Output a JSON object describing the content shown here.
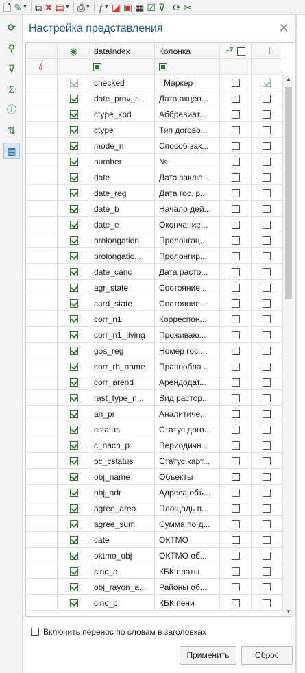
{
  "toolbar": {
    "icons": [
      "new-document-icon",
      "edit-pencil-icon",
      "copy-icon",
      "delete-icon",
      "export-icon",
      "print-icon",
      "formula-icon",
      "flag-icon",
      "report-icon",
      "preview-icon",
      "check-icon",
      "filter-icon",
      "refresh-icon",
      "tools-icon"
    ]
  },
  "sidebar": {
    "icons": [
      "refresh-icon",
      "search-icon",
      "filter-icon",
      "sum-icon",
      "info-icon",
      "sort-icon",
      "view-settings-icon"
    ],
    "glyphs": [
      "⟳",
      "⚲",
      "⊽",
      "Σ",
      "ⓘ",
      "⇅",
      "▦"
    ]
  },
  "panel": {
    "title": "Настройка представления",
    "close_glyph": "✕"
  },
  "grid": {
    "columns": {
      "visible_icon": "◉",
      "dataindex": "dataIndex",
      "kolonka": "Колонка",
      "wrap_icon": "⮐",
      "pin_icon": "⊣"
    },
    "rows": [
      {
        "visible": true,
        "gray": true,
        "dataindex": "checked",
        "kolonka": "=Маркер=",
        "wrap": false,
        "pinned": true
      },
      {
        "visible": true,
        "dataindex": "date_prov_r...",
        "kolonka": "Дата акцеп...",
        "wrap": false,
        "pinned": false
      },
      {
        "visible": true,
        "dataindex": "ctype_kod",
        "kolonka": "Аббревиат...",
        "wrap": false,
        "pinned": false
      },
      {
        "visible": true,
        "dataindex": "ctype",
        "kolonka": "Тип догово...",
        "wrap": false,
        "pinned": false
      },
      {
        "visible": true,
        "dataindex": "mode_n",
        "kolonka": "Способ зак...",
        "wrap": false,
        "pinned": false
      },
      {
        "visible": true,
        "dataindex": "number",
        "kolonka": "№",
        "wrap": false,
        "pinned": false
      },
      {
        "visible": true,
        "dataindex": "date",
        "kolonka": "Дата заклю...",
        "wrap": false,
        "pinned": false
      },
      {
        "visible": true,
        "dataindex": "date_reg",
        "kolonka": "Дата гос. р...",
        "wrap": false,
        "pinned": false
      },
      {
        "visible": true,
        "dataindex": "date_b",
        "kolonka": "Начало дей...",
        "wrap": false,
        "pinned": false
      },
      {
        "visible": true,
        "dataindex": "date_e",
        "kolonka": "Окончание...",
        "wrap": false,
        "pinned": false
      },
      {
        "visible": true,
        "dataindex": "prolongation",
        "kolonka": "Пролонгац...",
        "wrap": false,
        "pinned": false
      },
      {
        "visible": true,
        "dataindex": "prolongatio...",
        "kolonka": "Пролонгир...",
        "wrap": false,
        "pinned": false
      },
      {
        "visible": true,
        "dataindex": "date_canc",
        "kolonka": "Дата расто...",
        "wrap": false,
        "pinned": false
      },
      {
        "visible": true,
        "dataindex": "agr_state",
        "kolonka": "Состояние ...",
        "wrap": false,
        "pinned": false
      },
      {
        "visible": true,
        "dataindex": "card_state",
        "kolonka": "Состояние ...",
        "wrap": false,
        "pinned": false
      },
      {
        "visible": true,
        "dataindex": "corr_n1",
        "kolonka": "Корреспон...",
        "wrap": false,
        "pinned": false
      },
      {
        "visible": true,
        "dataindex": "corr_n1_living",
        "kolonka": "Проживаю...",
        "wrap": false,
        "pinned": false
      },
      {
        "visible": true,
        "dataindex": "gos_reg",
        "kolonka": "Номер гос....",
        "wrap": false,
        "pinned": false
      },
      {
        "visible": true,
        "dataindex": "corr_rh_name",
        "kolonka": "Правообла...",
        "wrap": false,
        "pinned": false
      },
      {
        "visible": true,
        "dataindex": "corr_arend",
        "kolonka": "Арендодат...",
        "wrap": false,
        "pinned": false
      },
      {
        "visible": true,
        "dataindex": "rast_type_n...",
        "kolonka": "Вид растор...",
        "wrap": false,
        "pinned": false
      },
      {
        "visible": true,
        "dataindex": "an_pr",
        "kolonka": "Аналитиче...",
        "wrap": false,
        "pinned": false
      },
      {
        "visible": true,
        "dataindex": "cstatus",
        "kolonka": "Статус дого...",
        "wrap": false,
        "pinned": false
      },
      {
        "visible": true,
        "dataindex": "c_nach_p",
        "kolonka": "Периодичн...",
        "wrap": false,
        "pinned": false
      },
      {
        "visible": true,
        "dataindex": "pc_cstatus",
        "kolonka": "Статус карт...",
        "wrap": false,
        "pinned": false
      },
      {
        "visible": true,
        "dataindex": "obj_name",
        "kolonka": "Объекты",
        "wrap": false,
        "pinned": false
      },
      {
        "visible": true,
        "dataindex": "obj_adr",
        "kolonka": "Адреса объ...",
        "wrap": false,
        "pinned": false
      },
      {
        "visible": true,
        "dataindex": "agree_area",
        "kolonka": "Площадь п...",
        "wrap": false,
        "pinned": false
      },
      {
        "visible": true,
        "dataindex": "agree_sum",
        "kolonka": "Сумма по д...",
        "wrap": false,
        "pinned": false
      },
      {
        "visible": true,
        "dataindex": "cate",
        "kolonka": "ОКТМО",
        "wrap": false,
        "pinned": false
      },
      {
        "visible": true,
        "dataindex": "oktmo_obj",
        "kolonka": "ОКТМО об...",
        "wrap": false,
        "pinned": false
      },
      {
        "visible": true,
        "dataindex": "cinc_a",
        "kolonka": "КБК платы",
        "wrap": false,
        "pinned": false
      },
      {
        "visible": true,
        "dataindex": "obj_rayon_a...",
        "kolonka": "Районы об...",
        "wrap": false,
        "pinned": false
      },
      {
        "visible": true,
        "dataindex": "cinc_p",
        "kolonka": "КБК пени",
        "wrap": false,
        "pinned": false
      }
    ]
  },
  "footer": {
    "wrap_label": "Включить перенос по словам в заголовках",
    "apply_label": "Применить",
    "reset_label": "Сброс"
  },
  "colors": {
    "accent_title": "#1d5f9e",
    "check_green": "#2e7d32",
    "delete_red": "#d13030"
  }
}
